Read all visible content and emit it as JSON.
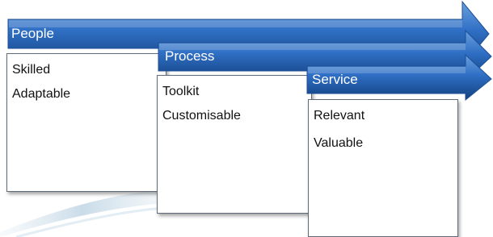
{
  "diagram": {
    "stages": [
      {
        "title": "People",
        "items": [
          "Skilled",
          "Adaptable"
        ]
      },
      {
        "title": "Process",
        "items": [
          "Toolkit",
          "Customisable"
        ]
      },
      {
        "title": "Service",
        "items": [
          "Relevant",
          "Valuable"
        ]
      }
    ],
    "colors": {
      "arrow_light": "#6aa0de",
      "arrow_mid": "#2f6fc4",
      "arrow_dark": "#13407f",
      "box_border": "#5f6b78",
      "swoosh": "#c9dbe8"
    }
  }
}
